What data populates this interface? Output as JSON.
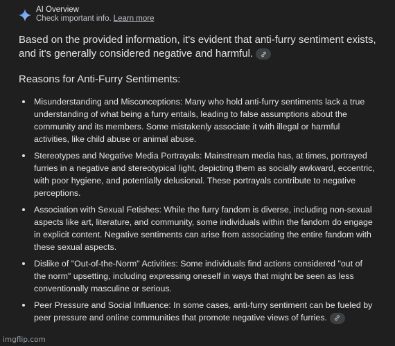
{
  "header": {
    "title": "AI Overview",
    "subtitle": "Check important info.",
    "learn_more": "Learn more",
    "icon": "sparkle-icon"
  },
  "intro": {
    "text": "Based on the provided information, it's evident that anti-furry sentiment exists, and it's generally considered negative and harmful.",
    "link_icon": "link-icon"
  },
  "section_heading": "Reasons for Anti-Furry Sentiments:",
  "bullets": [
    "Misunderstanding and Misconceptions: Many who hold anti-furry sentiments lack a true understanding of what being a furry entails, leading to false assumptions about the community and its members. Some mistakenly associate it with illegal or harmful activities, like child abuse or animal abuse.",
    "Stereotypes and Negative Media Portrayals: Mainstream media has, at times, portrayed furries in a negative and stereotypical light, depicting them as socially awkward, eccentric, with poor hygiene, and potentially delusional. These portrayals contribute to negative perceptions.",
    "Association with Sexual Fetishes: While the furry fandom is diverse, including non-sexual aspects like art, literature, and community, some individuals within the fandom do engage in explicit content. Negative sentiments can arise from associating the entire fandom with these sexual aspects.",
    "Dislike of \"Out-of-the-Norm\" Activities: Some individuals find actions considered \"out of the norm\" upsetting, including expressing oneself in ways that might be seen as less conventionally masculine or serious.",
    "Peer Pressure and Social Influence: In some cases, anti-furry sentiment can be fueled by peer pressure and online communities that promote negative views of furries."
  ],
  "watermark": "imgflip.com",
  "colors": {
    "background": "#1f1f1f",
    "text": "#e3e3e3",
    "chip": "#3c4043",
    "sparkle": "#8ab4f8"
  }
}
